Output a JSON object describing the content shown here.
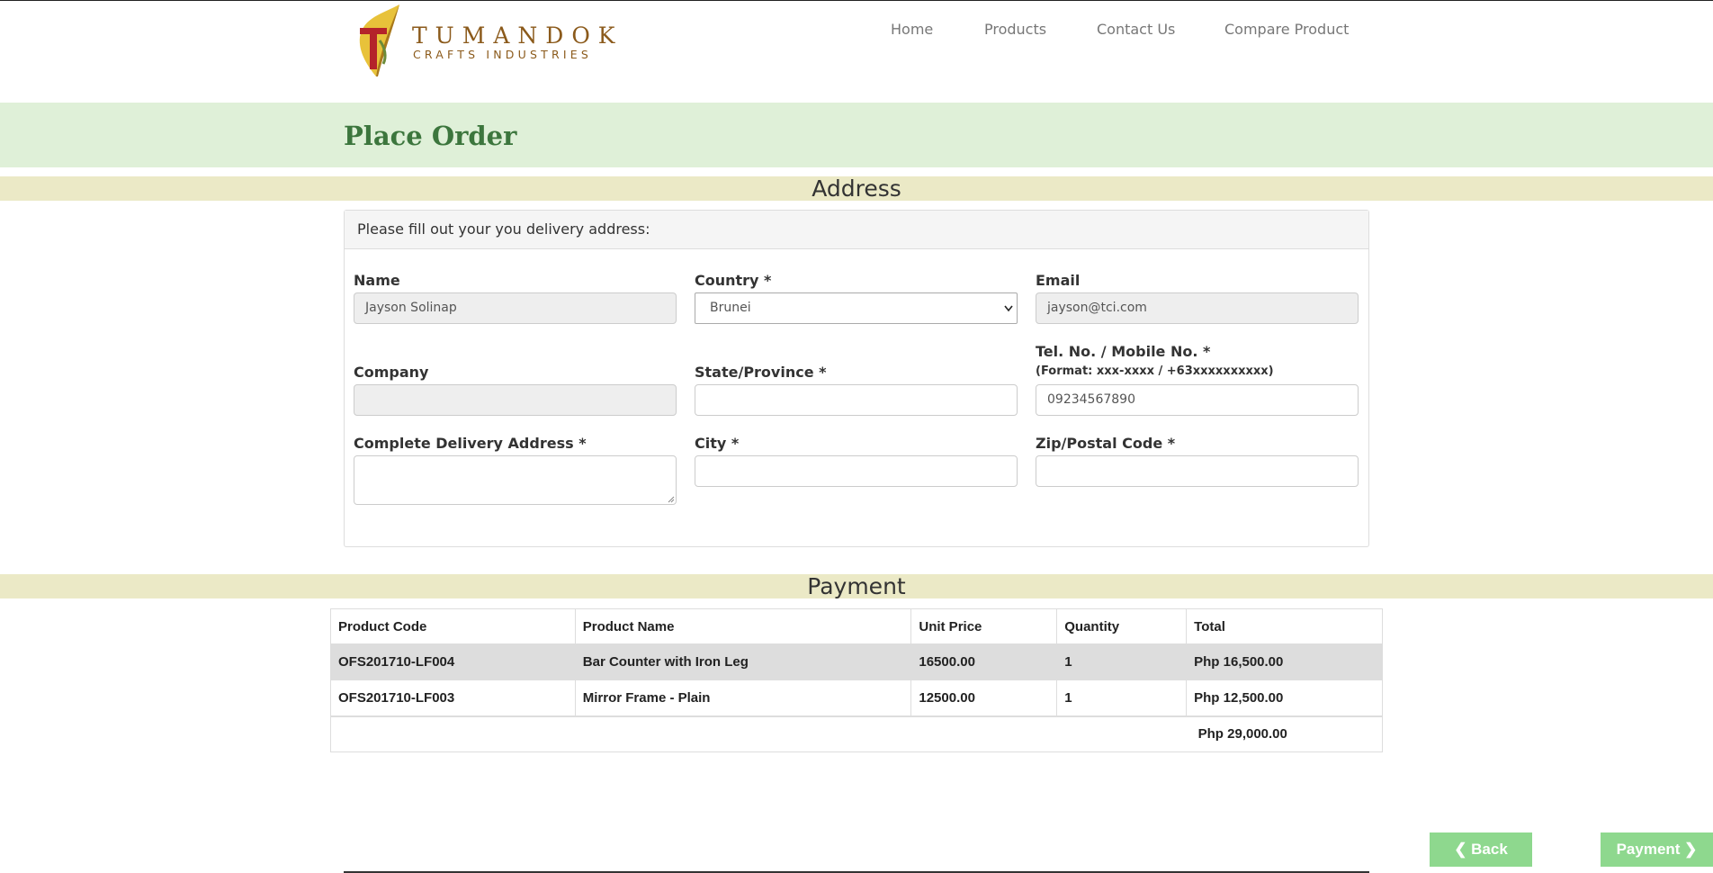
{
  "brand": {
    "name": "TUMANDOK",
    "tagline": "CRAFTS INDUSTRIES"
  },
  "nav": {
    "items": [
      "Home",
      "Products",
      "Contact Us",
      "Compare Product"
    ]
  },
  "page": {
    "title": "Place Order"
  },
  "address": {
    "section_title": "Address",
    "panel_heading": "Please fill out your you delivery address:",
    "name_label": "Name",
    "name_value": "Jayson Solinap",
    "country_label": "Country *",
    "country_value": "Brunei",
    "email_label": "Email",
    "email_value": "jayson@tci.com",
    "company_label": "Company",
    "company_value": "",
    "state_label": "State/Province *",
    "state_value": "",
    "tel_label": "Tel. No. / Mobile No. *",
    "tel_hint": "(Format: xxx-xxxx / +63xxxxxxxxxx)",
    "tel_value": "09234567890",
    "delivery_label": "Complete Delivery Address *",
    "delivery_value": "",
    "city_label": "City *",
    "city_value": "",
    "zip_label": "Zip/Postal Code *",
    "zip_value": ""
  },
  "payment": {
    "section_title": "Payment",
    "columns": [
      "Product Code",
      "Product Name",
      "Unit Price",
      "Quantity",
      "Total"
    ],
    "rows": [
      {
        "code": "OFS201710-LF004",
        "name": "Bar Counter with Iron Leg",
        "unit_price": "16500.00",
        "quantity": "1",
        "total": "Php 16,500.00"
      },
      {
        "code": "OFS201710-LF003",
        "name": "Mirror Frame - Plain",
        "unit_price": "12500.00",
        "quantity": "1",
        "total": "Php 12,500.00"
      }
    ],
    "grand_total": "Php 29,000.00"
  },
  "actions": {
    "back_label": "❮  Back",
    "payment_label": "Payment ❯"
  },
  "colors": {
    "brand_green": "#3c763d",
    "title_band": "#dff0d8",
    "section_band": "#ebe9c6",
    "button_green": "#8ed88e",
    "brand_brown": "#8b5a1b"
  }
}
